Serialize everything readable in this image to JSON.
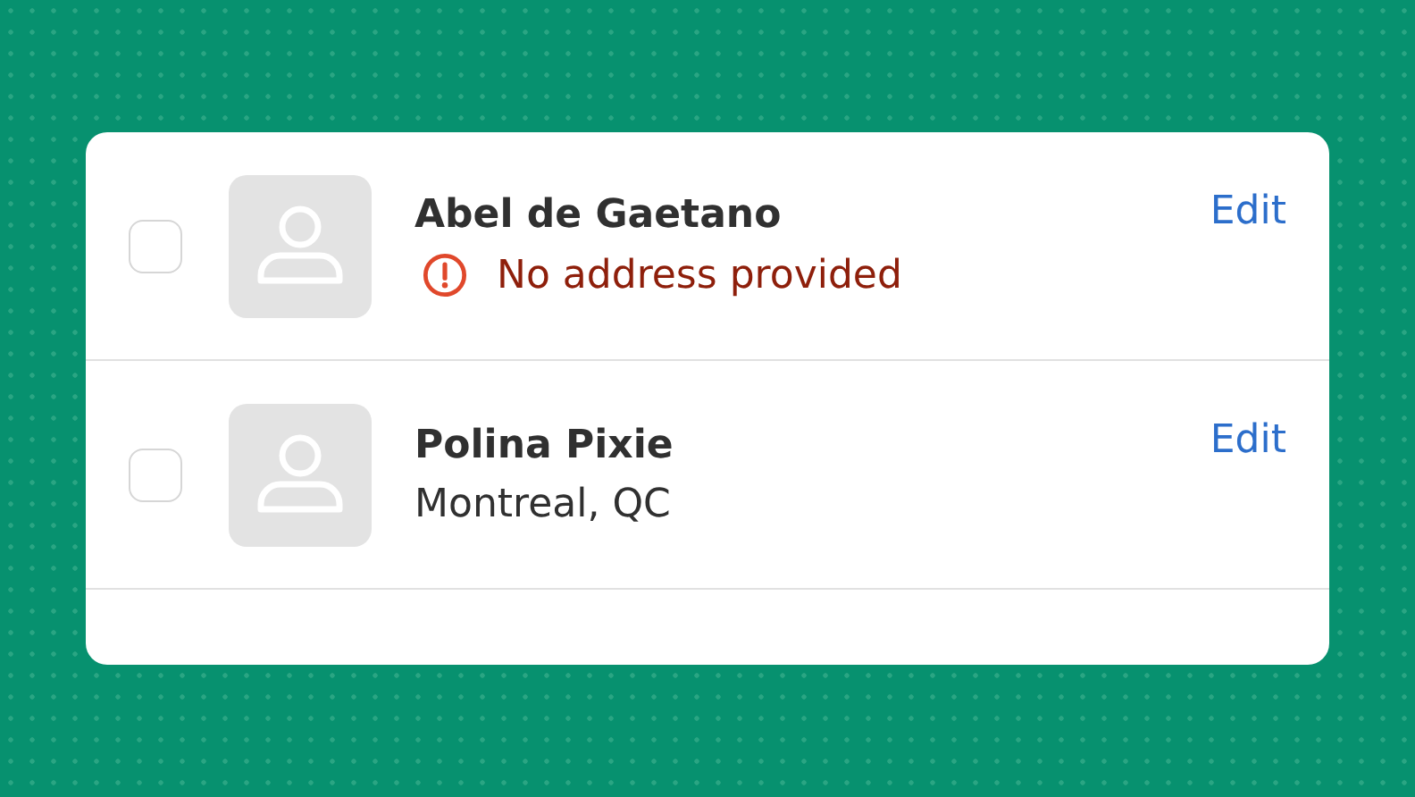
{
  "customers": [
    {
      "name": "Abel de Gaetano",
      "checked": false,
      "detail": {
        "kind": "warning",
        "text": "No address provided"
      },
      "action": "Edit"
    },
    {
      "name": "Polina Pixie",
      "checked": false,
      "detail": {
        "kind": "address",
        "text": "Montreal, QC"
      },
      "action": "Edit"
    }
  ]
}
